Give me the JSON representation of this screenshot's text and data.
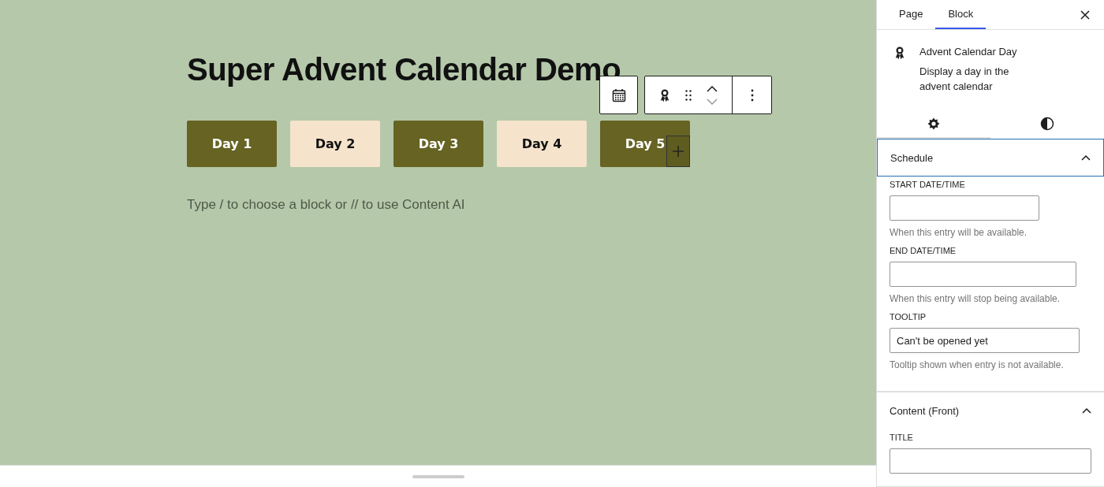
{
  "editor": {
    "title": "Super Advent Calendar Demo",
    "days": [
      {
        "label": "Day 1",
        "color": "#666323",
        "selected": false
      },
      {
        "label": "Day 2",
        "color": "#f5e3cc",
        "selected": false
      },
      {
        "label": "Day 3",
        "color": "#666323",
        "selected": false
      },
      {
        "label": "Day 4",
        "color": "#f5e3cc",
        "selected": false
      },
      {
        "label": "Day 5",
        "color": "#666323",
        "selected": true
      }
    ],
    "placeholder": "Type / to choose a block or // to use Content AI"
  },
  "sidebar": {
    "tabs": [
      {
        "label": "Page",
        "selected": false
      },
      {
        "label": "Block",
        "selected": true
      }
    ],
    "block": {
      "name": "Advent Calendar Day",
      "description": "Display a day in the advent calendar"
    },
    "view_tabs": [
      {
        "kind": "settings",
        "selected": true
      },
      {
        "kind": "styles",
        "selected": false
      }
    ],
    "panels": [
      {
        "title": "Schedule",
        "expanded": true,
        "focused": true,
        "fields": [
          {
            "label": "START DATE/TIME",
            "help": "When this entry will be available."
          },
          {
            "label": "END DATE/TIME",
            "help": "When this entry will stop being available."
          },
          {
            "label": "TOOLTIP",
            "value": "Can't be opened yet",
            "help": "Tooltip shown when entry is not available."
          }
        ]
      },
      {
        "title": "Content (Front)",
        "expanded": true,
        "focused": false,
        "fields": [
          {
            "label": "TITLE"
          }
        ]
      }
    ]
  }
}
